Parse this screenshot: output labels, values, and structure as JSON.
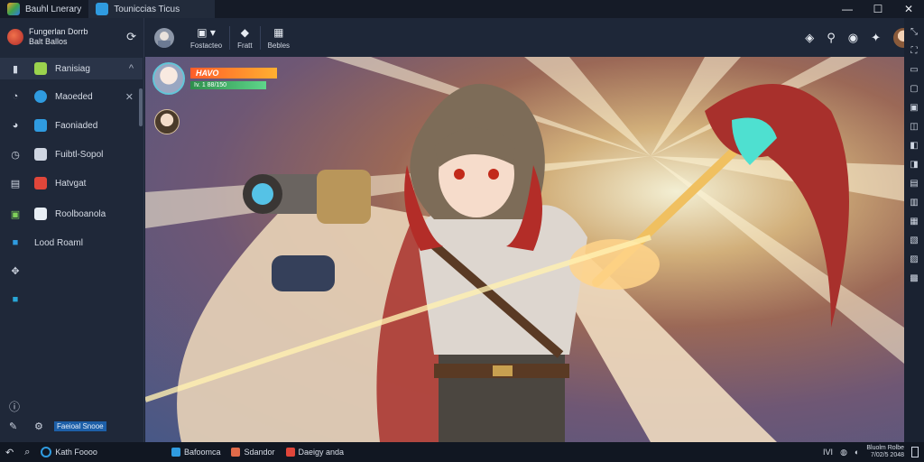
{
  "titlebar": {
    "tabs": [
      {
        "label": "Bauhl Lnerary",
        "icon": "app-cube-icon",
        "active": false
      },
      {
        "label": "Touniccias Ticus",
        "icon": "cloud-icon",
        "active": true
      }
    ],
    "controls": {
      "minimize": "—",
      "maximize": "☐",
      "close": "✕"
    }
  },
  "sidebar": {
    "profile": {
      "line1": "Fungerlan Dorrb",
      "line2": "Balt Ballos"
    },
    "items": [
      {
        "label": "Ranisiag",
        "icon": "gem-icon",
        "accent": "#9bd34d",
        "trail": "^",
        "active": true
      },
      {
        "label": "Maoeded",
        "icon": "clock-icon",
        "accent": "#2f9be0",
        "trail": "✕",
        "active": false
      },
      {
        "label": "Faoniaded",
        "icon": "store-icon",
        "accent": "#2f9be0",
        "trail": "",
        "active": false
      },
      {
        "label": "Fuibtl-Sopol",
        "icon": "history-icon",
        "accent": "#cfd6e2",
        "trail": "",
        "active": false
      },
      {
        "label": "Hatvgat",
        "icon": "folder-icon",
        "accent": "#e0463a",
        "trail": "",
        "active": false
      },
      {
        "label": "Roolboanola",
        "icon": "map-icon",
        "accent": "#e8eef5",
        "trail": "",
        "active": false
      },
      {
        "label": "Lood Roaml",
        "icon": "flag-icon",
        "accent": "#2f9be0",
        "trail": "",
        "active": false
      },
      {
        "label": "",
        "icon": "puzzle-icon",
        "accent": "#cfd6e2",
        "trail": "",
        "active": false
      },
      {
        "label": "",
        "icon": "globe-icon",
        "accent": "#29a7d8",
        "trail": "",
        "active": false
      }
    ],
    "footer": {
      "help": "ⓘ",
      "settings_label": "Faeioal Snooe"
    }
  },
  "toolbar": {
    "groups": [
      {
        "label": "Fostacteo",
        "icon": "grid-icon"
      },
      {
        "label": "Fratt",
        "icon": "cube-icon"
      },
      {
        "label": "Bebles",
        "icon": "table-icon"
      }
    ]
  },
  "hud": {
    "name": "HAVO",
    "level": "Iv. 1 88/150"
  },
  "taskbar": {
    "search_label": "Kath Foooo",
    "apps": [
      {
        "label": "Bafoomca",
        "color": "#2f9be0"
      },
      {
        "label": "Sdandor",
        "color": "#e06b4a"
      },
      {
        "label": "Daeigy anda",
        "color": "#e0463a"
      }
    ],
    "tray": {
      "lang": "IVI",
      "time": "Bluolm Rolbe",
      "date": "7/02/5 2048"
    }
  }
}
